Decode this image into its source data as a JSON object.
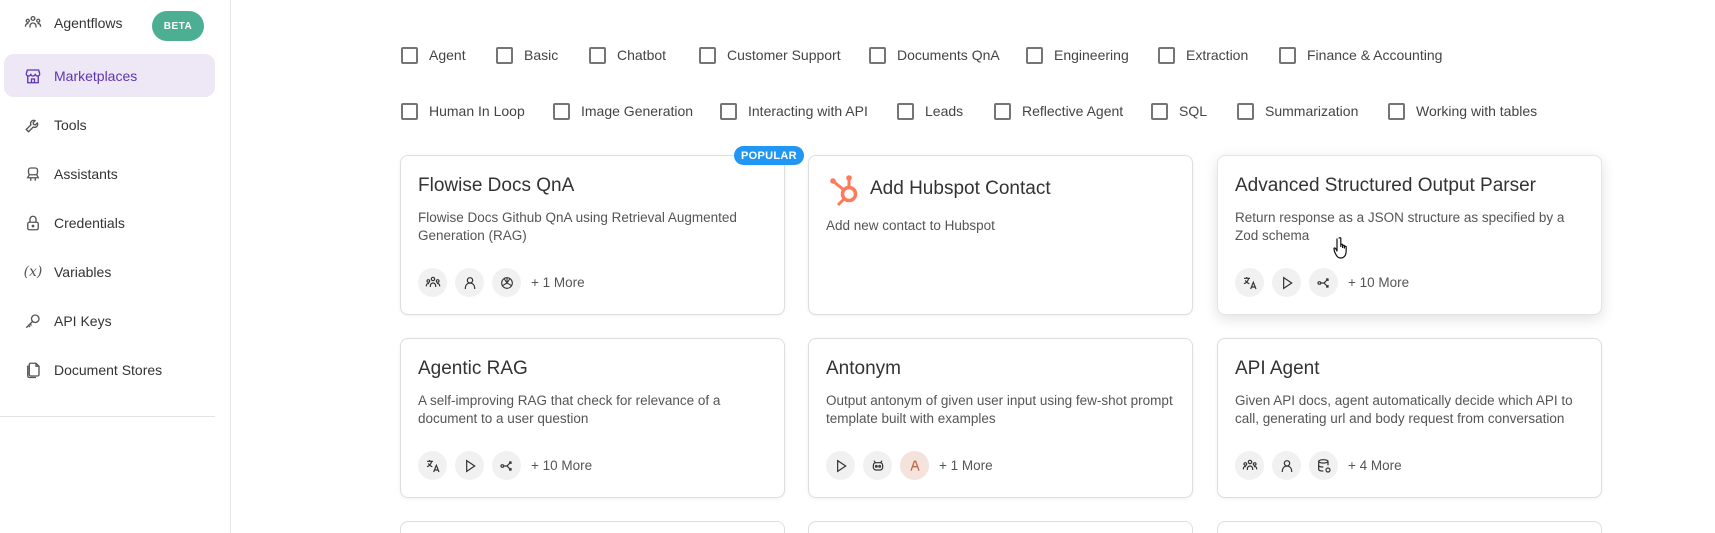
{
  "sidebar": {
    "items": [
      {
        "label": "Agentflows",
        "icon": "agentflows-icon",
        "badge": "BETA"
      },
      {
        "label": "Marketplaces",
        "icon": "store-icon",
        "active": true
      },
      {
        "label": "Tools",
        "icon": "tool-icon"
      },
      {
        "label": "Assistants",
        "icon": "robot-icon"
      },
      {
        "label": "Credentials",
        "icon": "lock-icon"
      },
      {
        "label": "Variables",
        "icon": "variable-icon"
      },
      {
        "label": "API Keys",
        "icon": "key-icon"
      },
      {
        "label": "Document Stores",
        "icon": "files-icon"
      }
    ]
  },
  "filters": {
    "row1": [
      "Agent",
      "Basic",
      "Chatbot",
      "Customer Support",
      "Documents QnA",
      "Engineering",
      "Extraction",
      "Finance & Accounting"
    ],
    "row2": [
      "Human In Loop",
      "Image Generation",
      "Interacting with API",
      "Leads",
      "Reflective Agent",
      "SQL",
      "Summarization",
      "Working with tables"
    ]
  },
  "cards": [
    {
      "title": "Flowise Docs QnA",
      "description": "Flowise Docs Github QnA using Retrieval Augmented Generation (RAG)",
      "badge": "POPULAR",
      "tags": [
        "agents-icon",
        "user-icon",
        "openai-icon"
      ],
      "more": "+ 1 More"
    },
    {
      "title": "Add Hubspot Contact",
      "description": "Add new contact to Hubspot",
      "logo": "hubspot-logo-icon",
      "tags": [],
      "more": ""
    },
    {
      "title": "Advanced Structured Output Parser",
      "description": "Return response as a JSON structure as specified by a Zod schema",
      "tags": [
        "translate-icon",
        "play-icon",
        "split-icon"
      ],
      "more": "+ 10 More"
    },
    {
      "title": "Agentic RAG",
      "description": "A self-improving RAG that check for relevance of a document to a user question",
      "tags": [
        "translate-icon",
        "play-icon",
        "split-icon"
      ],
      "more": "+ 10 More"
    },
    {
      "title": "Antonym",
      "description": "Output antonym of given user input using few-shot prompt template built with examples",
      "tags": [
        "play-icon",
        "robot-face-icon",
        "anthropic-icon"
      ],
      "more": "+ 1 More"
    },
    {
      "title": "API Agent",
      "description": "Given API docs, agent automatically decide which API to call, generating url and body request from conversation",
      "tags": [
        "agents-icon",
        "user-icon",
        "database-icon"
      ],
      "more": "+ 4 More"
    }
  ],
  "colors": {
    "accent": "#5e35b1",
    "active_bg": "#ede7f6",
    "beta": "#4caf93",
    "popular": "#2196f3",
    "hubspot": "#ff7a59"
  }
}
